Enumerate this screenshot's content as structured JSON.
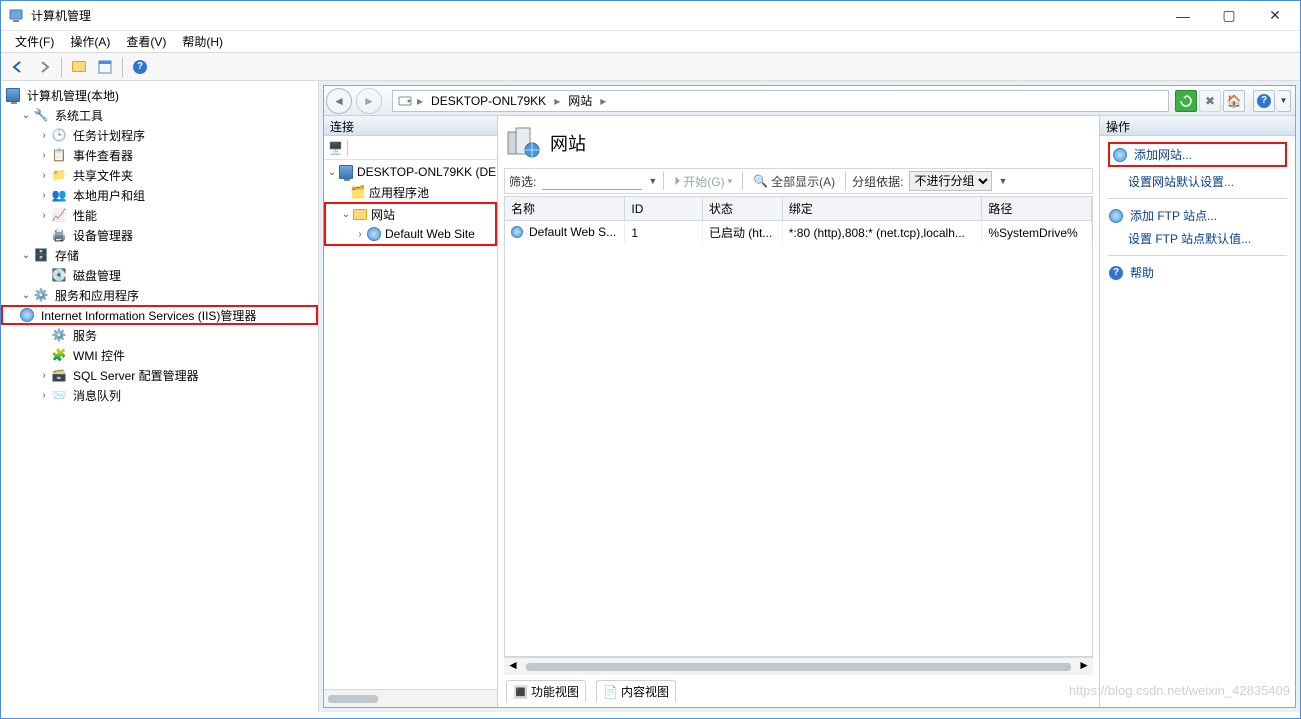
{
  "window": {
    "title": "计算机管理"
  },
  "menu": {
    "file": "文件(F)",
    "action": "操作(A)",
    "view": "查看(V)",
    "help": "帮助(H)"
  },
  "tree": {
    "root": "计算机管理(本地)",
    "systools": "系统工具",
    "systools_items": {
      "task": "任务计划程序",
      "event": "事件查看器",
      "shared": "共享文件夹",
      "users": "本地用户和组",
      "perf": "性能",
      "devmgr": "设备管理器"
    },
    "storage": "存储",
    "storage_items": {
      "disk": "磁盘管理"
    },
    "services": "服务和应用程序",
    "services_items": {
      "iis": "Internet Information Services (IIS)管理器",
      "svc": "服务",
      "wmi": "WMI 控件",
      "sql": "SQL Server 配置管理器",
      "msmq": "消息队列"
    }
  },
  "iis": {
    "breadcrumb": {
      "server": "DESKTOP-ONL79KK",
      "sites": "网站"
    },
    "connections": {
      "title": "连接",
      "server": "DESKTOP-ONL79KK (DE",
      "apppools": "应用程序池",
      "sites": "网站",
      "defaultsite": "Default Web Site"
    },
    "content": {
      "title": "网站",
      "filter_label": "筛选:",
      "filter_value": "",
      "start": "开始(G)",
      "showall": "全部显示(A)",
      "groupby_label": "分组依据:",
      "groupby_value": "不进行分组"
    },
    "grid": {
      "cols": {
        "name": "名称",
        "id": "ID",
        "status": "状态",
        "binding": "绑定",
        "path": "路径"
      },
      "rows": [
        {
          "name": "Default Web S...",
          "id": "1",
          "status": "已启动 (ht...",
          "binding": "*:80 (http),808:* (net.tcp),localh...",
          "path": "%SystemDrive%"
        }
      ]
    },
    "viewtabs": {
      "features": "功能视图",
      "content": "内容视图"
    },
    "actions": {
      "title": "操作",
      "add_site": "添加网站...",
      "set_default": "设置网站默认设置...",
      "add_ftp": "添加 FTP 站点...",
      "set_ftp_default": "设置 FTP 站点默认值...",
      "help": "帮助"
    }
  },
  "watermark": "https://blog.csdn.net/weixin_42835409"
}
